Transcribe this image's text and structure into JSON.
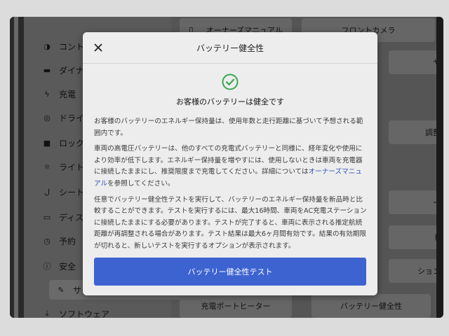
{
  "sidebar": {
    "items": [
      {
        "label": "コント",
        "icon": "toggle-icon"
      },
      {
        "label": "ダイナ",
        "icon": "car-icon"
      },
      {
        "label": "充電",
        "icon": "bolt-icon"
      },
      {
        "label": "ドライ",
        "icon": "steering-wheel-icon"
      },
      {
        "label": "ロック",
        "icon": "lock-icon"
      },
      {
        "label": "ライト",
        "icon": "light-icon"
      },
      {
        "label": "シート",
        "icon": "seat-icon"
      },
      {
        "label": "ディス",
        "icon": "display-icon"
      },
      {
        "label": "予約",
        "icon": "clock-icon"
      },
      {
        "label": "安全",
        "icon": "info-icon"
      },
      {
        "label": "サービス",
        "icon": "wrench-icon"
      },
      {
        "label": "ソフトウェア",
        "icon": "download-icon"
      }
    ]
  },
  "content": {
    "top_row": [
      {
        "label": "オーナーズマニュアル",
        "icon": "book-icon"
      },
      {
        "label": "フロントカメラ"
      }
    ],
    "right_fragments": [
      "ヤ",
      "調整",
      "ー",
      "ト",
      "ション"
    ],
    "bottom_row": [
      {
        "label": "充電ポートヒーター"
      },
      {
        "label": "バッテリー健全性"
      }
    ]
  },
  "modal": {
    "title": "バッテリー健全性",
    "status": "お客様のバッテリーは健全です",
    "paragraph1": "お客様のバッテリーのエネルギー保持量は、使用年数と走行距離に基づいて予想される範囲内です。",
    "paragraph2_before": "車両の高電圧バッテリーは、他のすべての充電式バッテリーと同様に、経年変化や使用により効率が低下します。エネルギー保持量を増やすには、使用しないときは車両を充電器に接続したままにし、推奨限度まで充電してください。詳細については",
    "paragraph2_link": "オーナーズマニュアル",
    "paragraph2_after": "を参照してください。",
    "paragraph3": "任意でバッテリー健全性テストを実行して、バッテリーのエネルギー保持量を新品時と比較することができます。テストを実行するには、最大16時間、車両をAC充電ステーションに接続したままにする必要があります。テストが完了すると、車両に表示される推定航続距離が再調整される場合があります。テスト結果は最大6ヶ月間有効です。結果の有効期限が切れると、新しいテストを実行するオプションが表示されます。",
    "button_label": "バッテリー健全性テスト"
  },
  "colors": {
    "accent": "#3d63d1",
    "check": "#3aa655",
    "link": "#2e55b8"
  }
}
